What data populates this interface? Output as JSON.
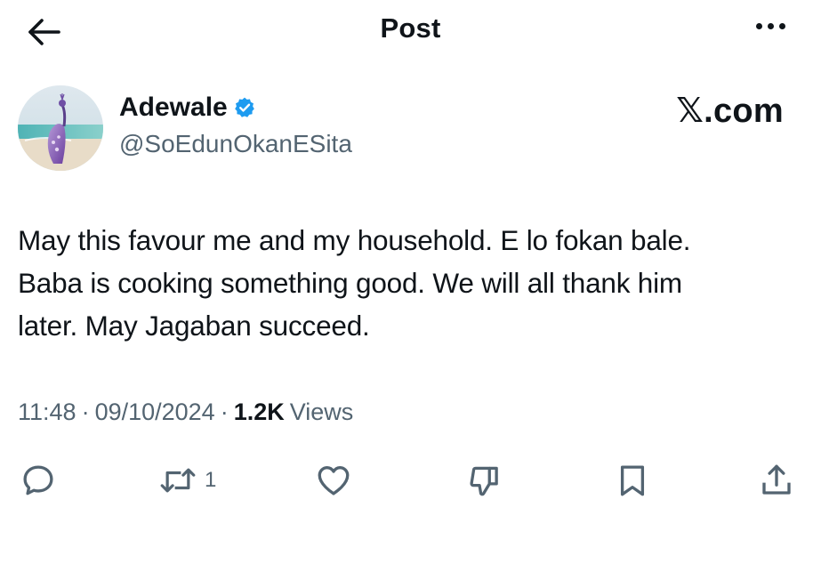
{
  "header": {
    "title": "Post",
    "back_icon": "arrow-left-icon",
    "more_icon": "more-horizontal-icon"
  },
  "author": {
    "name": "Adewale",
    "handle": "@SoEdunOkanESita",
    "verified": true,
    "verified_color": "#1d9bf0",
    "avatar_icon": "peacock-avatar"
  },
  "brand": {
    "label": "𝕏.com"
  },
  "post": {
    "text_lines": [
      "May this favour me and my household. E lo fokan bale.",
      "Baba is cooking something good. We will all thank him",
      "later. May Jagaban succeed."
    ]
  },
  "meta": {
    "time": "11:48",
    "separator": "·",
    "date": "09/10/2024",
    "views_count": "1.2K",
    "views_label": "Views"
  },
  "actions": {
    "reply_icon": "reply-icon",
    "repost_icon": "repost-icon",
    "repost_count": "1",
    "like_icon": "heart-icon",
    "dislike_icon": "dislike-icon",
    "bookmark_icon": "bookmark-icon",
    "share_icon": "share-icon"
  },
  "colors": {
    "text_primary": "#0f1419",
    "text_secondary": "#536471",
    "verified_badge": "#1d9bf0"
  }
}
